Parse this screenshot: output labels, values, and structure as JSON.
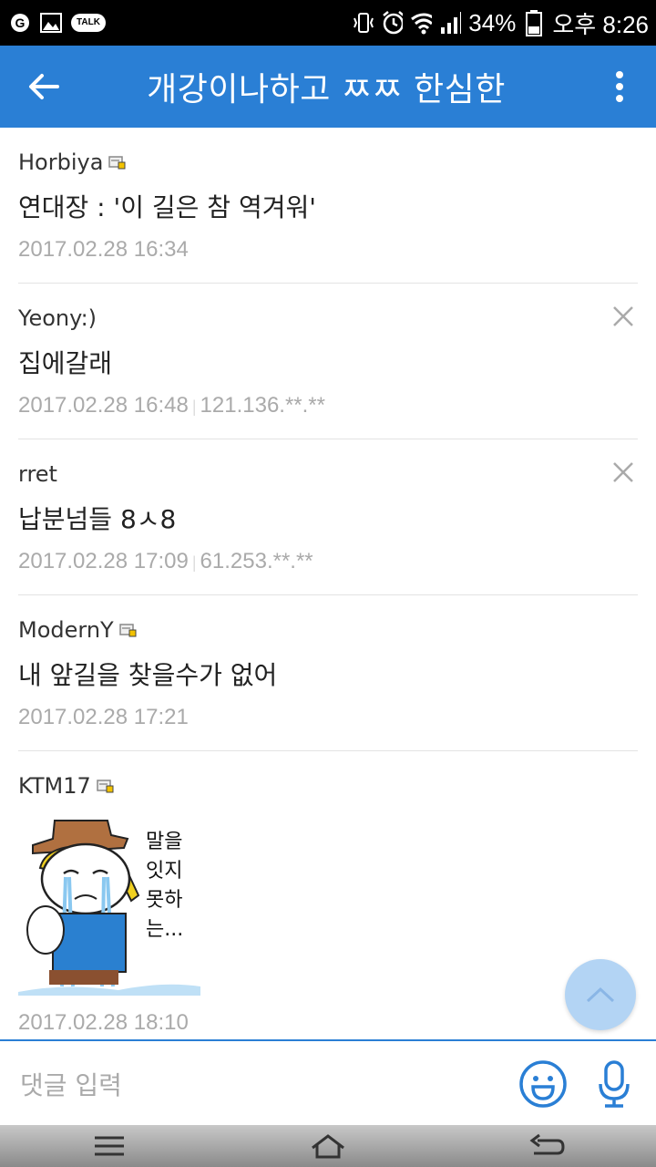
{
  "status_bar": {
    "battery": "34%",
    "time": "오후 8:26",
    "talk_label": "TALK"
  },
  "header": {
    "title": "개강이나하고 ㅉㅉ 한심한"
  },
  "comments": [
    {
      "author": "Horbiya",
      "body": "연대장 : '이 길은 참 역겨워'",
      "date": "2017.02.28 16:34",
      "ip": ""
    },
    {
      "author": "Yeony:)",
      "body": "집에갈래",
      "date": "2017.02.28 16:48",
      "ip": "121.136.**.**"
    },
    {
      "author": "rret",
      "body": "납분넘들 8ㅅ8",
      "date": "2017.02.28 17:09",
      "ip": "61.253.**.**"
    },
    {
      "author": "ModernY",
      "body": "내 앞길을 찾을수가 없어",
      "date": "2017.02.28 17:21",
      "ip": ""
    },
    {
      "author": "KTM17",
      "body": "",
      "date": "2017.02.28 18:10",
      "ip": "",
      "sticker_text": [
        "말을",
        "잇지",
        "못하",
        "는..."
      ]
    }
  ],
  "input": {
    "placeholder": "댓글 입력"
  },
  "colors": {
    "accent": "#2a7fd5",
    "fab": "#b3d4f4"
  }
}
